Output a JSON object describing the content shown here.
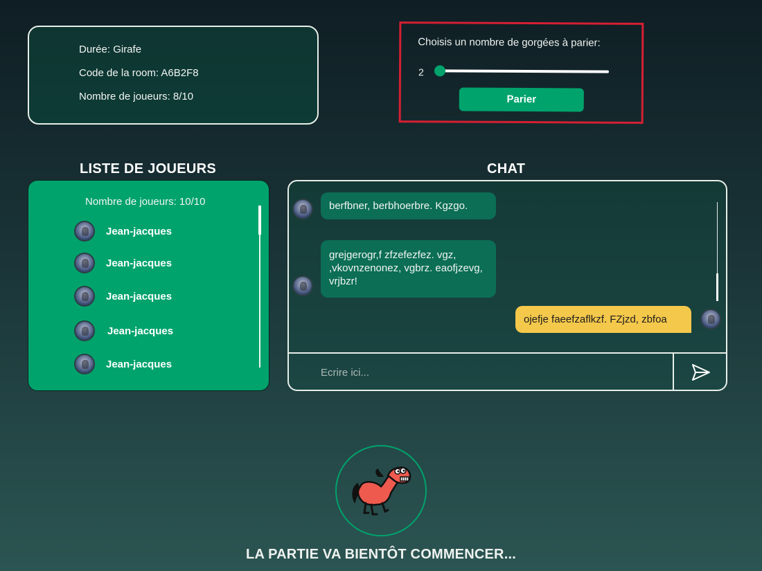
{
  "room_info": {
    "duration": "Durée: Girafe",
    "room_code": "Code de la room: A6B2F8",
    "players_count": "Nombre de joueurs: 8/10"
  },
  "bet": {
    "title": "Choisis un nombre de gorgées à parier:",
    "value": "2",
    "slider_fraction": 0.0,
    "button_label": "Parier"
  },
  "players": {
    "heading": "LISTE DE JOUEURS",
    "count": "Nombre de joueurs: 10/10",
    "items": [
      {
        "name": "Jean-jacques"
      },
      {
        "name": "Jean-jacques"
      },
      {
        "name": "Jean-jacques"
      },
      {
        "name": "Jean-jacques"
      },
      {
        "name": "Jean-jacques"
      }
    ]
  },
  "chat": {
    "heading": "CHAT",
    "messages": [
      {
        "side": "left",
        "text": "berfbner, berbhoerbre. Kgzgo."
      },
      {
        "side": "left",
        "text": "grejgerogr,f zfzefezfez. vgz, ,vkovnzenonez, vgbrz. eaofjzevg, vrjbzr!"
      },
      {
        "side": "right",
        "text": "ojefje faeefzaflkzf. FZjzd, zbfoa"
      }
    ],
    "input_placeholder": "Ecrire ici...",
    "send_icon": "send-icon"
  },
  "footer": {
    "status": "LA PARTIE VA BIENTÔT COMMENCER...",
    "mascot_icon": "horse-mascot"
  },
  "colors": {
    "accent": "#00a36c",
    "highlight": "#d61f33",
    "my_message": "#f4c84b",
    "other_message": "#0b6e55"
  }
}
